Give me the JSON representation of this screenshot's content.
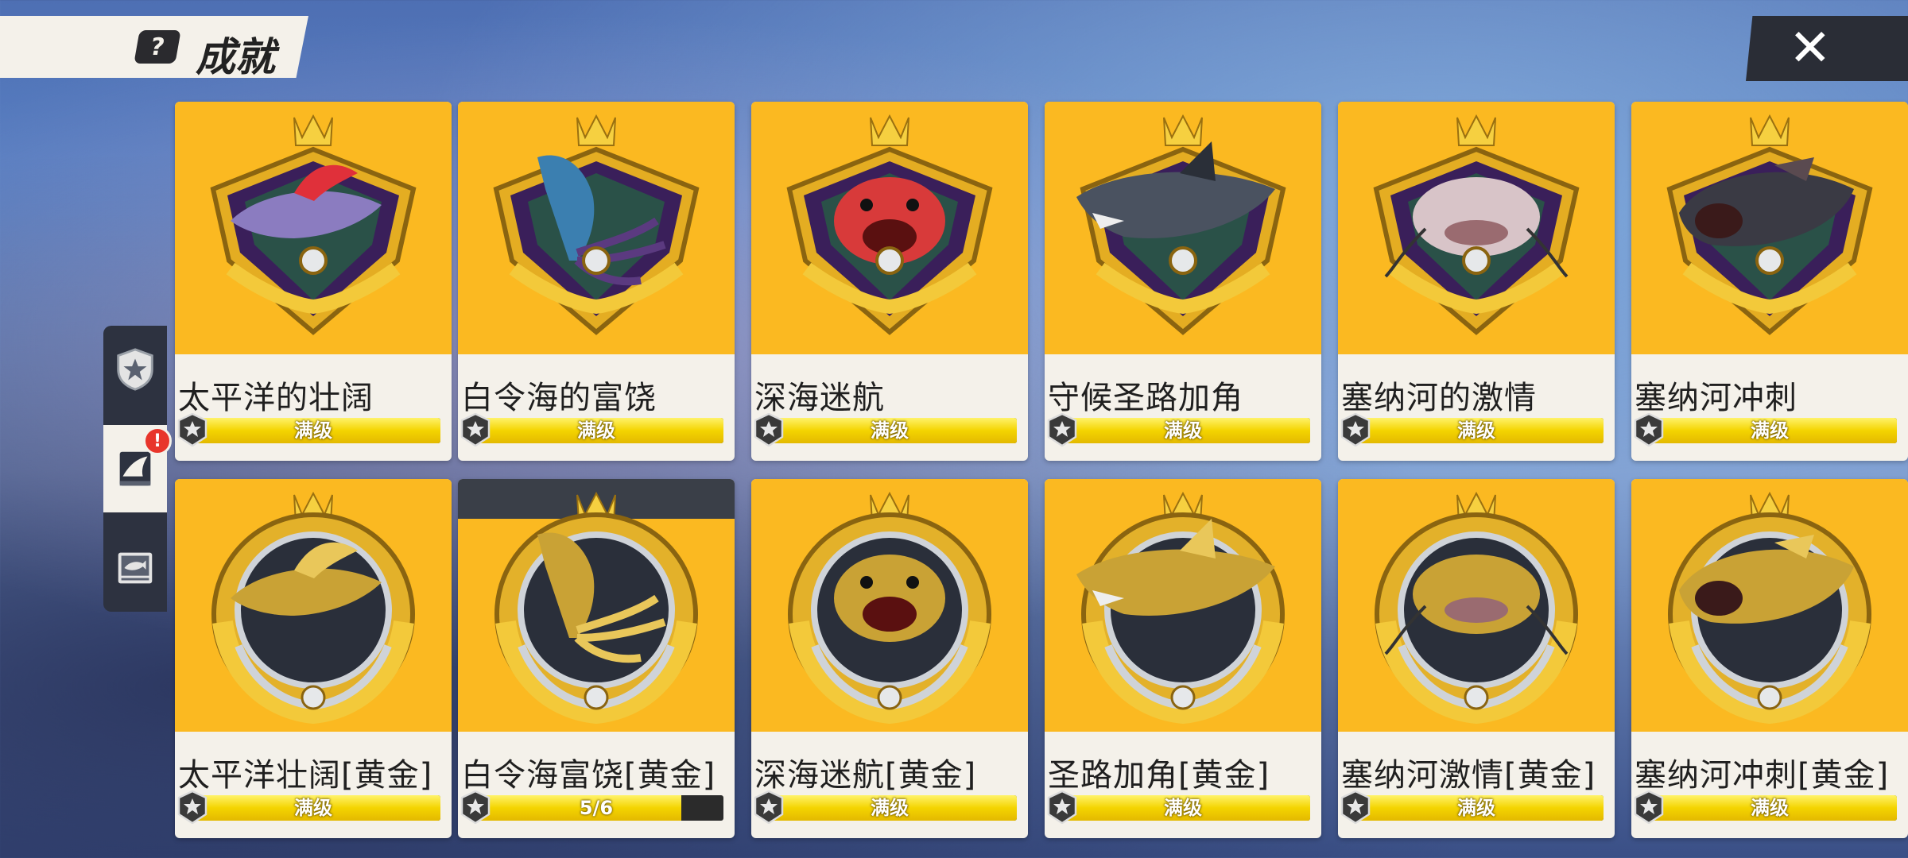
{
  "header": {
    "icon_name": "question-mark-icon",
    "icon_glyph": "?",
    "title": "成就",
    "close_glyph": "✕"
  },
  "side_nav": [
    {
      "icon": "star-shield-icon",
      "active": false,
      "alert": false
    },
    {
      "icon": "fish-fin-book-icon",
      "active": true,
      "alert": true,
      "alert_glyph": "!"
    },
    {
      "icon": "fish-photo-album-icon",
      "active": false,
      "alert": false
    }
  ],
  "colors": {
    "card_bg": "#fbb921",
    "card_footer": "#f4f1ea",
    "progress_fill": "#f4d400",
    "progress_track": "#2b2b2b",
    "alert": "#e8352b"
  },
  "rows": [
    [
      {
        "name": "太平洋的壮阔",
        "progress_text": "满级",
        "progress": 1.0,
        "emblem": "diamond-crest",
        "fish": "ribbonfish"
      },
      {
        "name": "白令海的富饶",
        "progress_text": "满级",
        "progress": 1.0,
        "emblem": "diamond-crest",
        "fish": "squid"
      },
      {
        "name": "深海迷航",
        "progress_text": "满级",
        "progress": 1.0,
        "emblem": "diamond-crest",
        "fish": "red-grouper"
      },
      {
        "name": "守候圣路加角",
        "progress_text": "满级",
        "progress": 1.0,
        "emblem": "diamond-crest",
        "fish": "shark"
      },
      {
        "name": "塞纳河的激情",
        "progress_text": "满级",
        "progress": 1.0,
        "emblem": "diamond-crest",
        "fish": "catfish"
      },
      {
        "name": "塞纳河冲刺",
        "progress_text": "满级",
        "progress": 1.0,
        "emblem": "diamond-crest",
        "fish": "bass"
      }
    ],
    [
      {
        "name": "太平洋壮阔[黄金]",
        "progress_text": "满级",
        "progress": 1.0,
        "emblem": "laurel-medal",
        "fish": "ribbonfish"
      },
      {
        "name": "白令海富饶[黄金]",
        "progress_text": "5/6",
        "progress": 0.833,
        "emblem": "laurel-medal",
        "fish": "squid",
        "incomplete": true
      },
      {
        "name": "深海迷航[黄金]",
        "progress_text": "满级",
        "progress": 1.0,
        "emblem": "laurel-medal",
        "fish": "red-grouper"
      },
      {
        "name": "圣路加角[黄金]",
        "progress_text": "满级",
        "progress": 1.0,
        "emblem": "laurel-medal",
        "fish": "shark"
      },
      {
        "name": "塞纳河激情[黄金]",
        "progress_text": "满级",
        "progress": 1.0,
        "emblem": "laurel-medal",
        "fish": "catfish"
      },
      {
        "name": "塞纳河冲刺[黄金]",
        "progress_text": "满级",
        "progress": 1.0,
        "emblem": "laurel-medal",
        "fish": "bass"
      }
    ]
  ]
}
